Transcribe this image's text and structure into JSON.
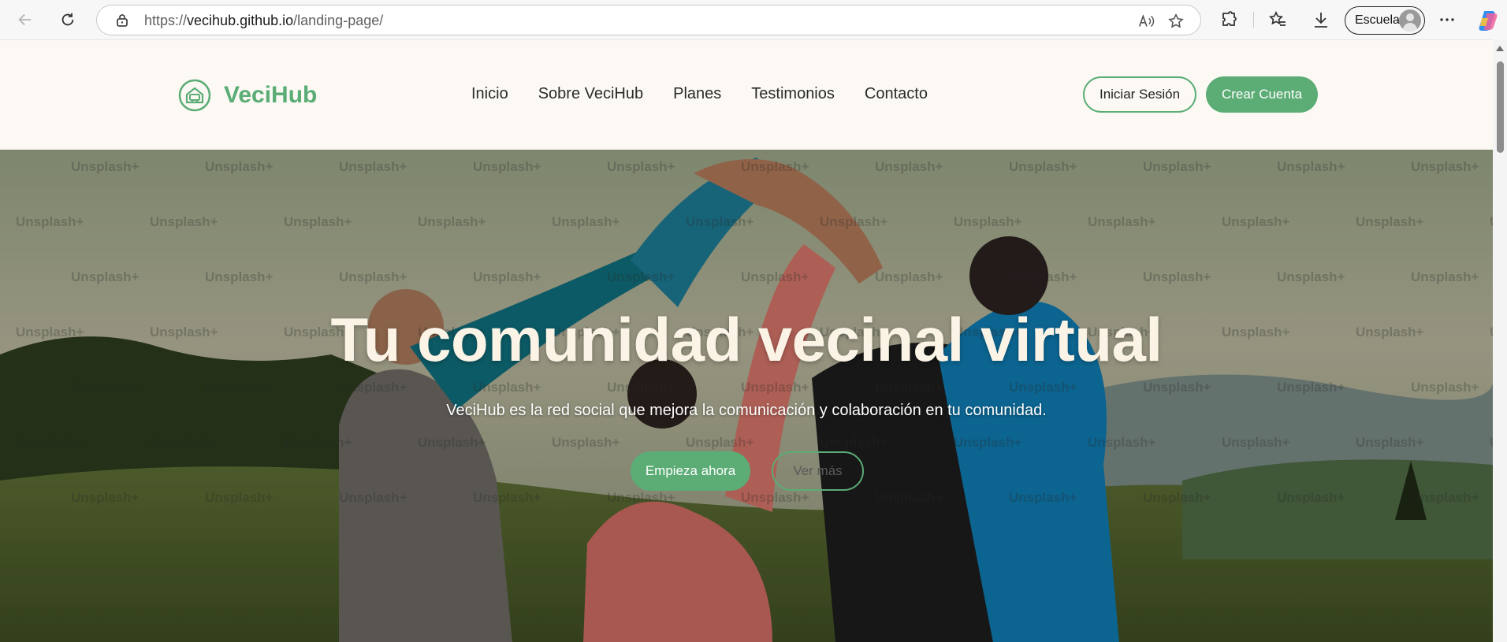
{
  "browser": {
    "url_prefix": "https://",
    "url_domain": "vecihub.github.io",
    "url_path": "/landing-page/",
    "profile_name": "Escuela",
    "icons": [
      "back-icon",
      "refresh-icon",
      "lock-icon",
      "read-aloud-icon",
      "favorite-star-icon",
      "extensions-icon",
      "favorites-icon",
      "download-icon",
      "more-icon",
      "copilot-icon"
    ]
  },
  "site": {
    "brand": "VeciHub",
    "nav": [
      "Inicio",
      "Sobre VeciHub",
      "Planes",
      "Testimonios",
      "Contacto"
    ],
    "login_label": "Iniciar Sesión",
    "signup_label": "Crear Cuenta"
  },
  "hero": {
    "title": "Tu comunidad vecinal virtual",
    "subtitle": "VeciHub es la red social que mejora la comunicación y colaboración en tu comunidad.",
    "primary_cta": "Empieza ahora",
    "secondary_cta": "Ver más",
    "watermark": "Unsplash+"
  },
  "colors": {
    "accent": "#5bac75",
    "header_bg": "#fcf9f4",
    "hero_title": "#fbf4e6"
  }
}
